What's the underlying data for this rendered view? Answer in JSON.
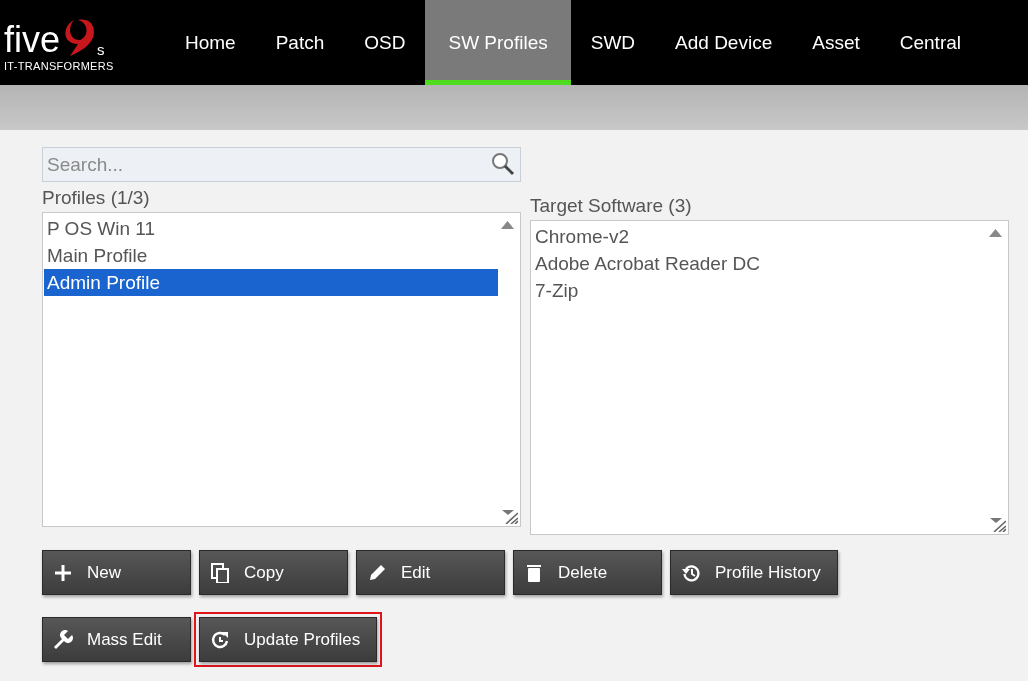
{
  "logo": {
    "word": "five",
    "suffix": "s",
    "tagline": "IT-TRANSFORMERS"
  },
  "nav": [
    {
      "label": "Home",
      "selected": false
    },
    {
      "label": "Patch",
      "selected": false
    },
    {
      "label": "OSD",
      "selected": false
    },
    {
      "label": "SW Profiles",
      "selected": true
    },
    {
      "label": "SWD",
      "selected": false
    },
    {
      "label": "Add Device",
      "selected": false
    },
    {
      "label": "Asset",
      "selected": false
    },
    {
      "label": "Central",
      "selected": false
    }
  ],
  "search": {
    "placeholder": "Search..."
  },
  "profiles": {
    "title": "Profiles (1/3)",
    "items": [
      {
        "label": "P OS Win 11",
        "selected": false
      },
      {
        "label": "Main Profile",
        "selected": false
      },
      {
        "label": "Admin Profile",
        "selected": true
      }
    ]
  },
  "target_software": {
    "title": "Target Software (3)",
    "items": [
      {
        "label": "Chrome-v2"
      },
      {
        "label": "Adobe Acrobat Reader DC"
      },
      {
        "label": "7-Zip"
      }
    ]
  },
  "button_rows": [
    [
      {
        "label": "New",
        "highlighted": false
      },
      {
        "label": "Copy",
        "highlighted": false
      },
      {
        "label": "Edit",
        "highlighted": false
      },
      {
        "label": "Delete",
        "highlighted": false
      },
      {
        "label": "Profile History",
        "highlighted": false
      }
    ],
    [
      {
        "label": "Mass Edit",
        "highlighted": false
      },
      {
        "label": "Update Profiles",
        "highlighted": true
      }
    ]
  ]
}
